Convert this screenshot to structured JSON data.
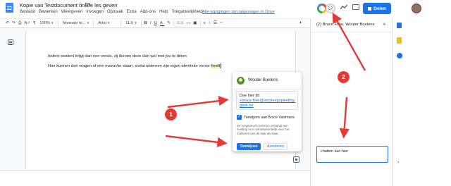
{
  "header": {
    "title": "Kopie van Testdocument online les geven",
    "menu": [
      "Bestand",
      "Bewerken",
      "Weergeven",
      "Invoegen",
      "Opmaak",
      "Extra",
      "Add-ons",
      "Help",
      "Toegankelijkheid"
    ],
    "saved_link": "Alle wijzigingen zijn opgeslagen in Drive",
    "share_label": "Delen"
  },
  "toolbar": {
    "zoom": "100%",
    "style": "Normale te...",
    "font": "Arial",
    "size": "11.5"
  },
  "document": {
    "line1": "Iedere student krijgt dan een versie, zij dienen deze dan wel met jou te delen",
    "line2_main": "Hier kunnen dan vragen of een instructie staan, zodat iedereen zijn eigen identieke versie ",
    "line2_highlight": "heeft"
  },
  "comment": {
    "author": "Wouter Buelens",
    "text_prefix": "Doe hier dit",
    "mention": "+bruce.fixer@verpleegopleiding-genk.be",
    "assign_label": "Toewijzen aan Bruce Vastmans",
    "note": "De toegewezen persoon ontvangt een melding en is verantwoordelijk voor het markeren van de taak als klaar.",
    "assign_button": "Toewijzen",
    "cancel_button": "Annuleren"
  },
  "chat": {
    "title": "(2) Bruce Fixer, Wouter Buelens",
    "input_value": "chatten kan hier"
  },
  "annotations": {
    "badge1": "1",
    "badge2": "2",
    "color": "#e53935"
  }
}
